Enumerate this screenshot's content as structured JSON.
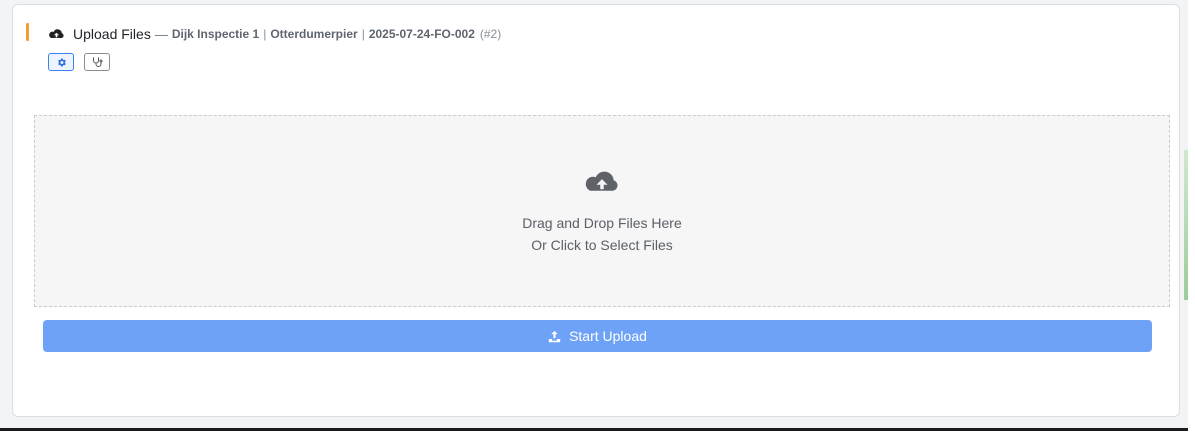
{
  "header": {
    "icon": "cloud-upload-icon",
    "title": "Upload Files",
    "separator": "—",
    "project": "Dijk Inspectie 1",
    "pipe1": "|",
    "site": "Otterdumerpier",
    "pipe2": "|",
    "code": "2025-07-24-FO-002",
    "number": "(#2)"
  },
  "toolbar": {
    "settings_icon": "gear-icon",
    "stethoscope_icon": "stethoscope-icon"
  },
  "dropzone": {
    "icon": "cloud-upload-icon",
    "line1": "Drag and Drop Files Here",
    "line2": "Or Click to Select Files"
  },
  "upload_button": {
    "icon": "upload-icon",
    "label": "Start Upload"
  },
  "colors": {
    "accent": "#f0a030",
    "primary": "#6ea2f7",
    "settings_border": "#3b82f6"
  }
}
